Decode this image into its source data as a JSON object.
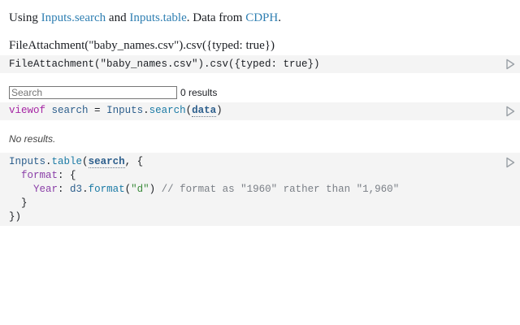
{
  "intro": {
    "prefix": "Using ",
    "link1": "Inputs.search",
    "and": " and ",
    "link2": "Inputs.table",
    "mid": ". Data from ",
    "link3": "CDPH",
    "suffix": "."
  },
  "cell1": {
    "output_text": "FileAttachment(\"baby_names.csv\").csv({typed: true})",
    "source": "FileAttachment(\"baby_names.csv\").csv({typed: true})"
  },
  "search": {
    "placeholder": "Search",
    "results_text": "0 results"
  },
  "cell2": {
    "t_viewof": "viewof",
    "t_search": "search",
    "t_eq": " = ",
    "t_inputs": "Inputs",
    "t_dot": ".",
    "t_searchfn": "search",
    "t_open": "(",
    "t_data": "data",
    "t_close": ")"
  },
  "table_output": {
    "message": "No results."
  },
  "cell3": {
    "l1_inputs": "Inputs",
    "l1_dot": ".",
    "l1_table": "table",
    "l1_open": "(",
    "l1_search": "search",
    "l1_rest": ", {",
    "l2_indent": "  ",
    "l2_format": "format",
    "l2_rest": ": {",
    "l3_indent": "    ",
    "l3_year": "Year",
    "l3_colon": ": ",
    "l3_d3": "d3",
    "l3_dot": ".",
    "l3_formatfn": "format",
    "l3_open": "(",
    "l3_str": "\"d\"",
    "l3_close": ")",
    "l3_comment": " // format as \"1960\" rather than \"1,960\"",
    "l4": "  }",
    "l5": "})"
  },
  "icons": {
    "run": "run-triangle-icon"
  }
}
